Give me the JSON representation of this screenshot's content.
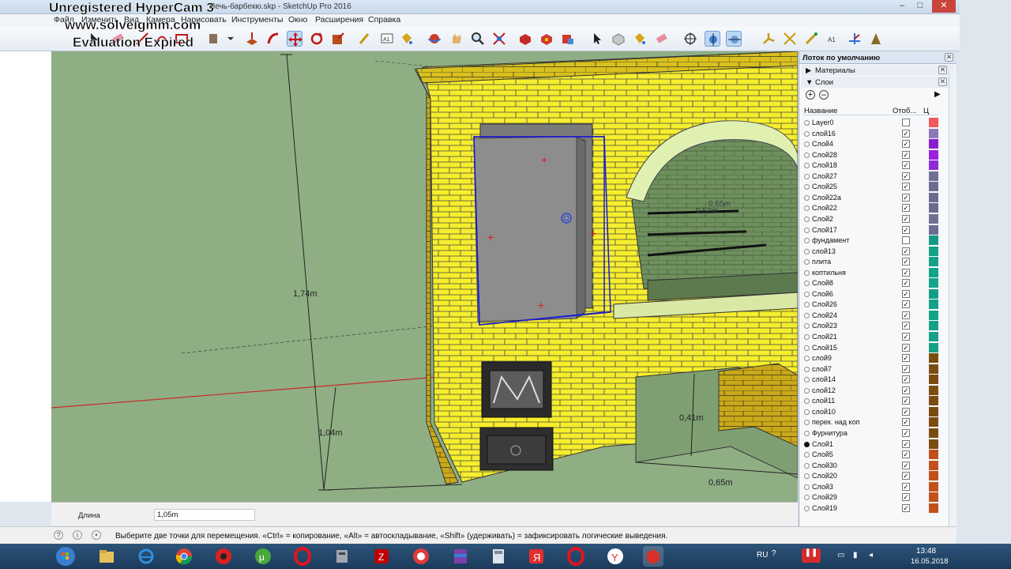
{
  "window": {
    "title": "Печь-барбекю.skp - SketchUp Pro 2016",
    "min": "–",
    "max": "□",
    "close": "✕"
  },
  "watermark": {
    "line1": "Unregistered HyperCam 3",
    "line2": "www.solveigmm.com",
    "line3": "Evaluation Expired"
  },
  "menu": [
    {
      "label": "Файл"
    },
    {
      "label": "Изменить"
    },
    {
      "label": "Вид"
    },
    {
      "label": "Камера"
    },
    {
      "label": "Нарисовать"
    },
    {
      "label": "Инструменты"
    },
    {
      "label": "Окно"
    },
    {
      "label": "Расширения"
    },
    {
      "label": "Справка"
    }
  ],
  "toolbar": {
    "active_tool": "move-tool",
    "tools": [
      "select",
      "eraser",
      "line",
      "arc",
      "shape",
      "push-pull",
      "follow-me",
      "move",
      "rotate",
      "scale",
      "tape-measure",
      "text",
      "paint-bucket",
      "orbit",
      "pan",
      "zoom",
      "zoom-extents",
      "components",
      "warehouse",
      "extension-warehouse",
      "section-plane",
      "style",
      "paint",
      "erase",
      "axes",
      "x-ray",
      "back-edges",
      "walk",
      "position-camera",
      "look-around",
      "dimension",
      "protractor"
    ]
  },
  "viewport": {
    "dimensions": [
      "1,74m",
      "1,04m",
      "0,41m",
      "0,65m",
      "0,65m",
      "0,52m"
    ]
  },
  "tray": {
    "title": "Лоток по умолчанию",
    "materials_label": "Материалы",
    "layers_label": "Слои",
    "columns": {
      "name": "Название",
      "visible": "Отоб...",
      "color": "Ц"
    },
    "layers": [
      {
        "name": "Layer0",
        "visible": false,
        "color": "#f05a5a",
        "active": false
      },
      {
        "name": "слой16",
        "visible": true,
        "color": "#8e79b8",
        "active": false
      },
      {
        "name": "Слой4",
        "visible": true,
        "color": "#8a1fd1",
        "active": false
      },
      {
        "name": "Слой28",
        "visible": true,
        "color": "#9a22dd",
        "active": false
      },
      {
        "name": "Слой18",
        "visible": true,
        "color": "#8f2ad8",
        "active": false
      },
      {
        "name": "Слой27",
        "visible": true,
        "color": "#6e6e96",
        "active": false
      },
      {
        "name": "Слой25",
        "visible": true,
        "color": "#6d6d94",
        "active": false
      },
      {
        "name": "Слой22а",
        "visible": true,
        "color": "#6b6b8f",
        "active": false
      },
      {
        "name": "Слой22",
        "visible": true,
        "color": "#6a6a90",
        "active": false
      },
      {
        "name": "Слой2",
        "visible": true,
        "color": "#707095",
        "active": false
      },
      {
        "name": "Слой17",
        "visible": true,
        "color": "#6c6c92",
        "active": false
      },
      {
        "name": "фундамент",
        "visible": false,
        "color": "#149a83",
        "active": false
      },
      {
        "name": "слой13",
        "visible": true,
        "color": "#14a085",
        "active": false
      },
      {
        "name": "плита",
        "visible": true,
        "color": "#14a089",
        "active": false
      },
      {
        "name": "коптильня",
        "visible": true,
        "color": "#13a28a",
        "active": false
      },
      {
        "name": "Слой8",
        "visible": true,
        "color": "#15a58d",
        "active": false
      },
      {
        "name": "Слой6",
        "visible": true,
        "color": "#139f86",
        "active": false
      },
      {
        "name": "Слой26",
        "visible": true,
        "color": "#14a188",
        "active": false
      },
      {
        "name": "Слой24",
        "visible": true,
        "color": "#12a287",
        "active": false
      },
      {
        "name": "Слой23",
        "visible": true,
        "color": "#14a089",
        "active": false
      },
      {
        "name": "Слой21",
        "visible": true,
        "color": "#15a08a",
        "active": false
      },
      {
        "name": "Слой15",
        "visible": true,
        "color": "#14a186",
        "active": false
      },
      {
        "name": "слой9",
        "visible": true,
        "color": "#7a4c10",
        "active": false
      },
      {
        "name": "слой7",
        "visible": true,
        "color": "#7b4d12",
        "active": false
      },
      {
        "name": "слой14",
        "visible": true,
        "color": "#7c4b10",
        "active": false
      },
      {
        "name": "слой12",
        "visible": true,
        "color": "#7a4d11",
        "active": false
      },
      {
        "name": "слой11",
        "visible": true,
        "color": "#7b4c12",
        "active": false
      },
      {
        "name": "слой10",
        "visible": true,
        "color": "#7a4b10",
        "active": false
      },
      {
        "name": "перек. над коп",
        "visible": true,
        "color": "#7c4c11",
        "active": false
      },
      {
        "name": "Фурнитура",
        "visible": true,
        "color": "#7b4d10",
        "active": false
      },
      {
        "name": "Слой1",
        "visible": true,
        "color": "#7a4c12",
        "active": true
      },
      {
        "name": "Слой5",
        "visible": true,
        "color": "#c0501a",
        "active": false
      },
      {
        "name": "Слой30",
        "visible": true,
        "color": "#c2501c",
        "active": false
      },
      {
        "name": "Слой20",
        "visible": true,
        "color": "#c34f1a",
        "active": false
      },
      {
        "name": "Слой3",
        "visible": true,
        "color": "#c1511b",
        "active": false
      },
      {
        "name": "Слой29",
        "visible": true,
        "color": "#c0521a",
        "active": false
      },
      {
        "name": "Слой19",
        "visible": true,
        "color": "#c3501b",
        "active": false
      }
    ]
  },
  "measurements": {
    "label": "Длина",
    "value": "1,05m"
  },
  "status": {
    "text": "Выберите две точки для перемещения.  «Ctrl» = копирование, «Alt» = автоскладывание, «Shift» (удерживать) = зафиксировать логические выведения."
  },
  "taskbar": {
    "lang": "RU",
    "time": "13:48",
    "date": "16.05.2018"
  }
}
